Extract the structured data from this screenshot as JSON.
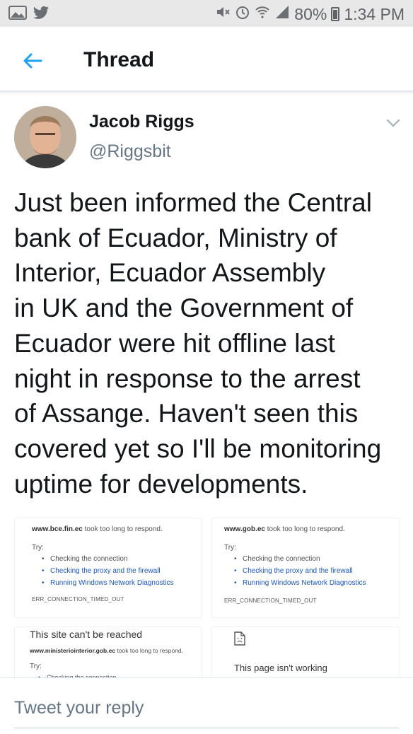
{
  "status_bar": {
    "left_icons": [
      "image-icon",
      "twitter-bird-icon"
    ],
    "right_icons": [
      "mute-icon",
      "alarm-icon",
      "wifi-icon",
      "signal-icon",
      "battery-icon"
    ],
    "battery": "80%",
    "time": "1:34 PM"
  },
  "header": {
    "back_icon": "arrow-left-icon",
    "title": "Thread"
  },
  "tweet": {
    "author_name": "Jacob Riggs",
    "author_handle": "@Riggsbit",
    "lines": [
      "Just been informed the Central",
      "bank of Ecuador, Ministry of",
      "Interior, Ecuador Assembly",
      "in UK and the Government of",
      "Ecuador were hit offline last",
      "night in response to the arrest",
      "of Assange. Haven't seen this",
      "covered yet so I'll be monitoring",
      "uptime for developments."
    ],
    "media": [
      {
        "domain": "www.bce.fin.ec",
        "message": " took too long to respond.",
        "try": "Try:",
        "bullets": [
          "Checking the connection",
          "Checking the proxy and the firewall",
          "Running Windows Network Diagnostics"
        ],
        "error": "ERR_CONNECTION_TIMED_OUT"
      },
      {
        "domain": "www.gob.ec",
        "message": " took too long to respond.",
        "try": "Try:",
        "bullets": [
          "Checking the connection",
          "Checking the proxy and the firewall",
          "Running Windows Network Diagnostics"
        ],
        "error": "ERR_CONNECTION_TIMED_OUT"
      },
      {
        "heading": "This site can't be reached",
        "domain": "www.ministeriointerior.gob.ec",
        "message": " took too long to respond.",
        "try": "Try:",
        "bullets": [
          "Checking the connection"
        ]
      },
      {
        "icon": "sad-document-icon",
        "heading": "This page isn't working"
      }
    ]
  },
  "reply": {
    "placeholder": "Tweet your reply"
  },
  "colors": {
    "accent": "#1da1f2",
    "text": "#14171a",
    "secondary": "#657786",
    "link": "#1a57c5"
  }
}
